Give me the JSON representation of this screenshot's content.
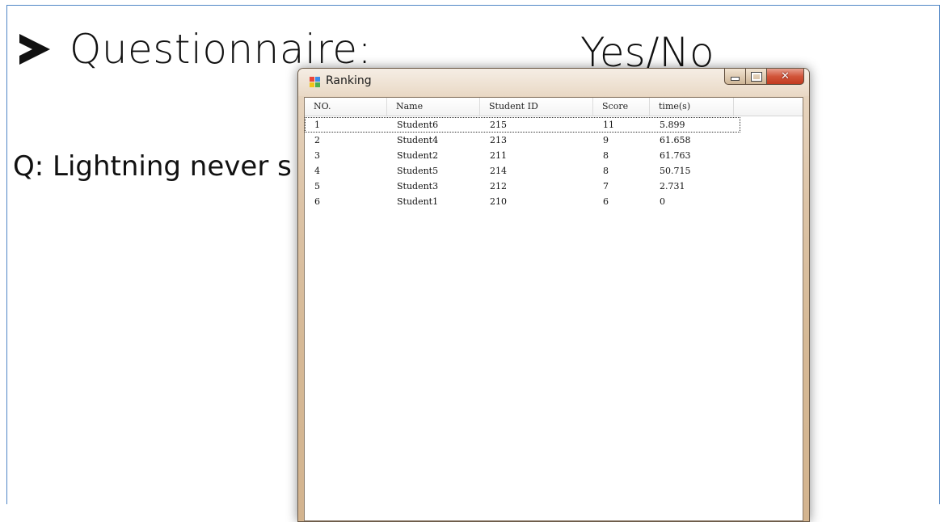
{
  "slide": {
    "title": "Questionnaire:",
    "answer_type": "Yes/No",
    "question": "Q: Lightning never s"
  },
  "window": {
    "title": "Ranking",
    "controls": {
      "minimize": "minimize-icon",
      "maximize": "maximize-icon",
      "close": "✕"
    }
  },
  "table": {
    "headers": [
      "NO.",
      "Name",
      "Student ID",
      "Score",
      "time(s)"
    ],
    "rows": [
      [
        "1",
        "Student6",
        "215",
        "11",
        "5.899"
      ],
      [
        "2",
        "Student4",
        "213",
        "9",
        "61.658"
      ],
      [
        "3",
        "Student2",
        "211",
        "8",
        "61.763"
      ],
      [
        "4",
        "Student5",
        "214",
        "8",
        "50.715"
      ],
      [
        "5",
        "Student3",
        "212",
        "7",
        "2.731"
      ],
      [
        "6",
        "Student1",
        "210",
        "6",
        "0"
      ]
    ]
  },
  "colors": {
    "slide_border": "#4f86c6",
    "window_frame": "#d6b996",
    "close_button": "#c8452a"
  }
}
